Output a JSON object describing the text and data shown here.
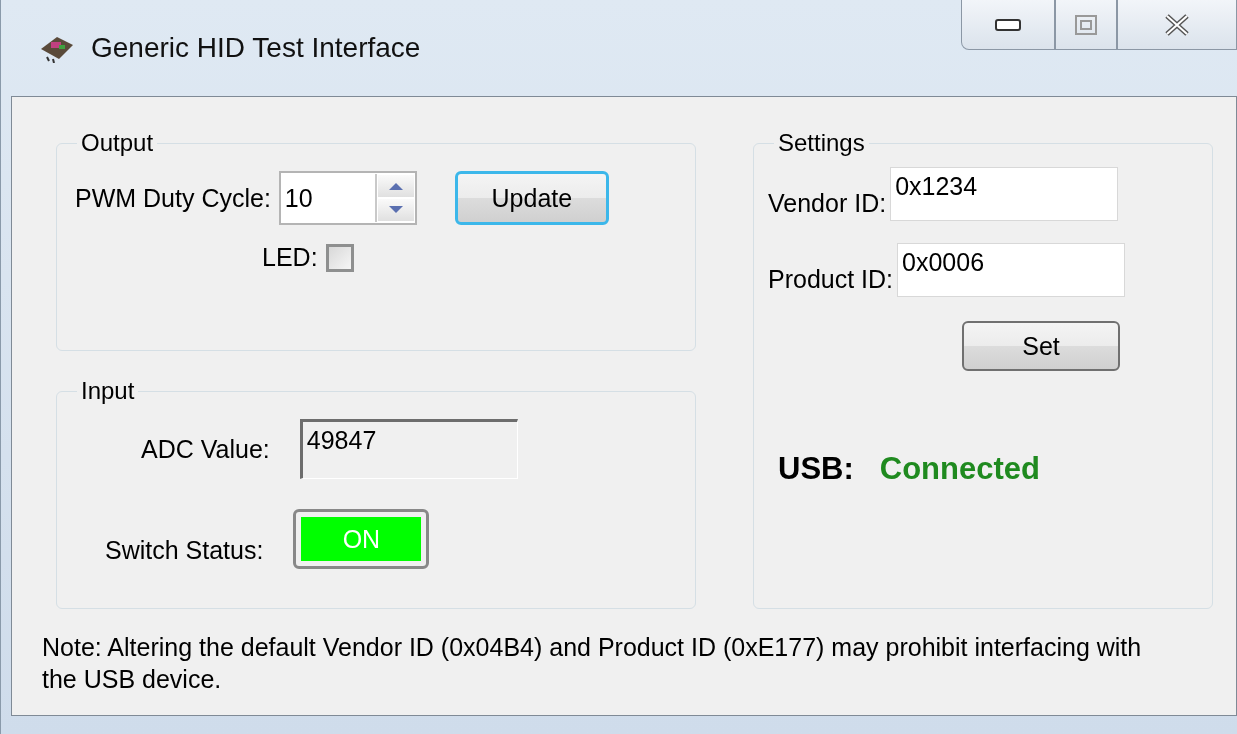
{
  "window": {
    "title": "Generic HID Test Interface"
  },
  "output": {
    "title": "Output",
    "pwm_label": "PWM Duty Cycle:",
    "pwm_value": "10",
    "update_button": "Update",
    "led_label": "LED:",
    "led_checked": false
  },
  "input": {
    "title": "Input",
    "adc_label": "ADC Value:",
    "adc_value": "49847",
    "switch_label": "Switch Status:",
    "switch_text": "ON",
    "switch_on": true
  },
  "settings": {
    "title": "Settings",
    "vendor_label": "Vendor ID:",
    "vendor_value": "0x1234",
    "product_label": "Product ID:",
    "product_value": "0x0006",
    "set_button": "Set",
    "usb_label": "USB:",
    "usb_status": "Connected",
    "usb_connected": true
  },
  "note": "Note: Altering the default Vendor ID (0x04B4) and Product ID (0xE177) may prohibit interfacing with the USB device."
}
